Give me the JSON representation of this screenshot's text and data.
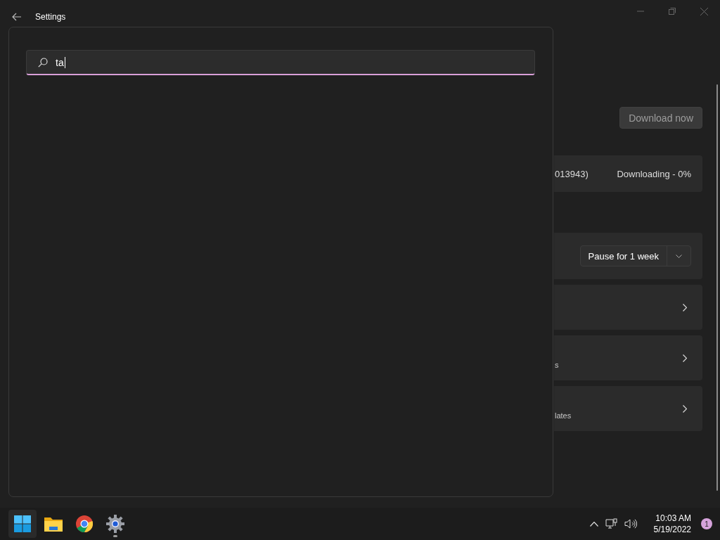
{
  "window": {
    "title": "Settings"
  },
  "search": {
    "value": "ta"
  },
  "content": {
    "download_button": "Download now",
    "update": {
      "name": "013943)",
      "status": "Downloading - 0%"
    },
    "pause": {
      "value": "Pause for 1 week"
    },
    "rows": [
      {
        "text": null
      },
      {
        "text": "s"
      },
      {
        "text": "lates"
      }
    ]
  },
  "taskbar": {
    "apps": [
      {
        "kind": "start",
        "running": false,
        "hovered": true
      },
      {
        "kind": "folder",
        "running": false,
        "hovered": false
      },
      {
        "kind": "browser",
        "running": false,
        "hovered": false
      },
      {
        "kind": "settings",
        "running": true,
        "hovered": false
      }
    ],
    "time": "10:03 AM",
    "date": "5/19/2022",
    "notifications": "1"
  }
}
